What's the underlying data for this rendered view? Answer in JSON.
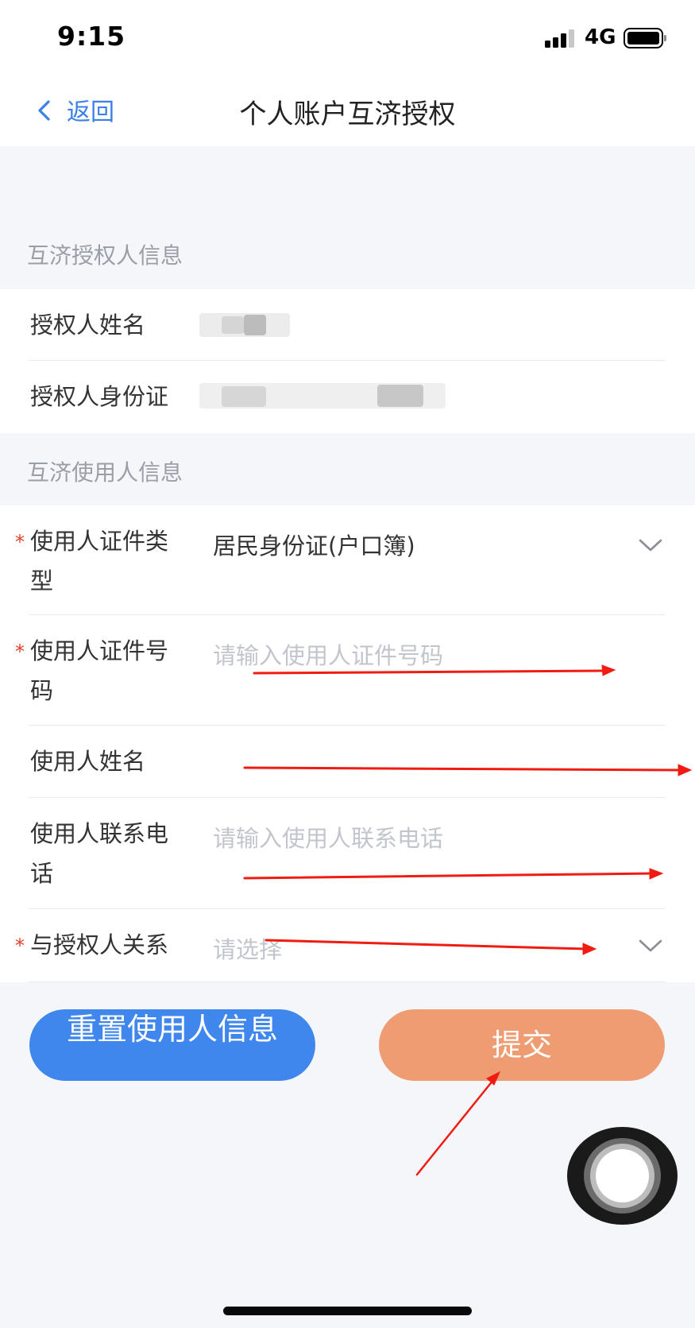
{
  "status_bar": {
    "time": "9:15",
    "network": "4G"
  },
  "nav": {
    "back_label": "返回",
    "title": "个人账户互济授权"
  },
  "authorizer_section": {
    "header": "互济授权人信息",
    "name_label": "授权人姓名",
    "id_label": "授权人身份证"
  },
  "user_section": {
    "header": "互济使用人信息",
    "id_type": {
      "label": "使用人证件类型",
      "required": "*",
      "value": "居民身份证(户口簿)"
    },
    "id_number": {
      "label": "使用人证件号码",
      "required": "*",
      "placeholder": "请输入使用人证件号码"
    },
    "name": {
      "label": "使用人姓名"
    },
    "phone": {
      "label": "使用人联系电话",
      "placeholder": "请输入使用人联系电话"
    },
    "relation": {
      "label": "与授权人关系",
      "required": "*",
      "placeholder": "请选择"
    }
  },
  "buttons": {
    "reset": "重置使用人信息",
    "submit": "提交"
  },
  "colors": {
    "accent_blue": "#3f87ec",
    "submit_orange": "#f09c73",
    "required_red": "#e0402a",
    "annotation_red": "#f01c12"
  }
}
